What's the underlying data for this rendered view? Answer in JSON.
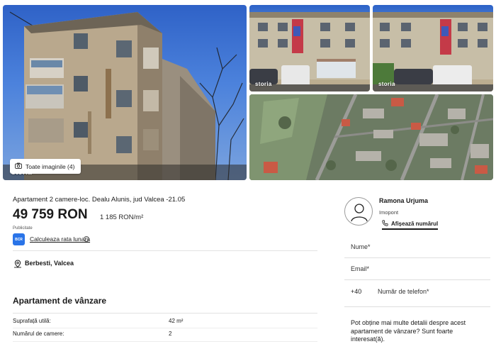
{
  "gallery": {
    "all_images_label": "Toate imaginile (4)",
    "watermark": "storia",
    "camera_icon": "camera-icon"
  },
  "listing": {
    "title": "Apartament 2 camere-loc. Dealu Alunis, jud Valcea -21.05",
    "price": "49 759 RON",
    "price_per_m2": "1 185 RON/m²",
    "ad_label": "Publicitate",
    "bank_logo_text": "BCR",
    "calc_link": "Calculeaza rata lunara",
    "info_icon": "info-icon",
    "location": "Berbesti, Valcea",
    "section_title": "Apartament de vânzare",
    "specs": [
      {
        "label": "Suprafață utilă:",
        "value": "42 m²"
      },
      {
        "label": "Numărul de camere:",
        "value": "2"
      }
    ]
  },
  "contact": {
    "agent_name": "Ramona Urjuma",
    "agent_company": "Imopont",
    "show_number_label": "Afișează numărul",
    "fields": {
      "name_placeholder": "Nume*",
      "email_placeholder": "Email*",
      "phone_prefix": "+40",
      "phone_placeholder": "Număr de telefon*"
    },
    "message": "Pot obține mai multe detalii despre acest apartament de vânzare? Sunt foarte interesat(ă)."
  },
  "colors": {
    "sky": "#3a6fd0",
    "bank_blue": "#2a74e8",
    "text": "#1a1a1a"
  }
}
